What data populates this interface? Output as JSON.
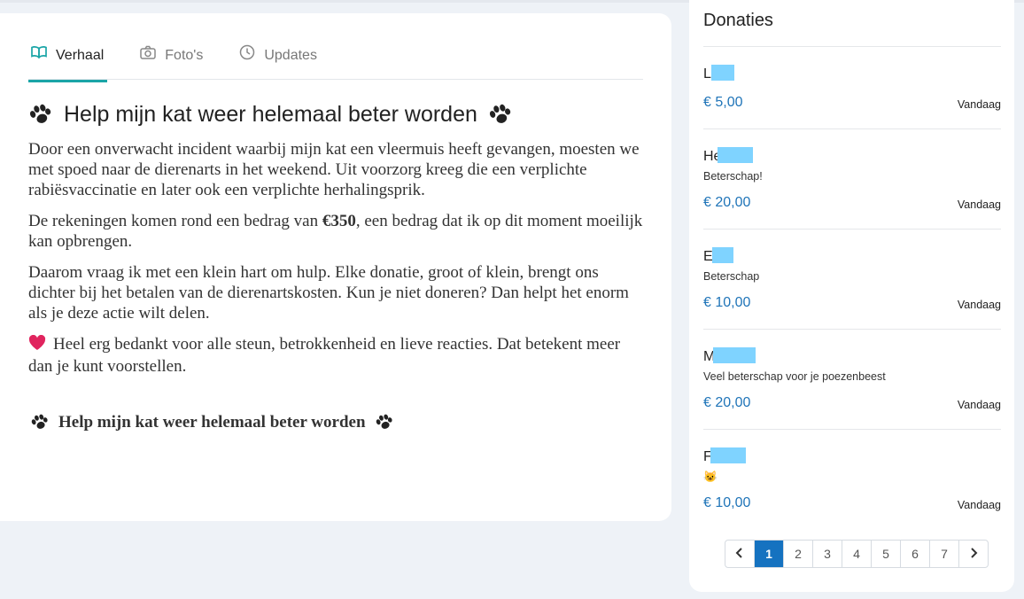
{
  "tabs": [
    {
      "label": "Verhaal",
      "icon": "book-icon",
      "active": true
    },
    {
      "label": "Foto's",
      "icon": "camera-icon",
      "active": false
    },
    {
      "label": "Updates",
      "icon": "clock-icon",
      "active": false
    }
  ],
  "story": {
    "title": "Help mijn kat weer helemaal beter worden",
    "p1": "Door een onverwacht incident waarbij mijn kat een vleermuis heeft gevangen, moesten we met spoed naar de dierenarts in het weekend. Uit voorzorg kreeg die een verplichte rabiësvaccinatie en later ook een verplichte herhalingsprik.",
    "p2_before": "De rekeningen komen rond een bedrag van ",
    "p2_bold": "€350",
    "p2_after": ", een bedrag dat ik op dit moment moeilijk kan opbrengen.",
    "p3": "Daarom vraag ik met een klein hart om hulp. Elke donatie, groot of klein, brengt ons dichter bij het betalen van de dierenartskosten. Kun je niet doneren? Dan helpt het enorm als je deze actie wilt delen.",
    "p4": "Heel erg bedankt voor alle steun, betrokkenheid en lieve reacties. Dat betekent meer dan je kunt voorstellen.",
    "subtitle": "Help mijn kat weer helemaal beter worden"
  },
  "donations": {
    "title": "Donaties",
    "items": [
      {
        "initial": "L",
        "message": "",
        "amount": "€ 5,00",
        "date": "Vandaag"
      },
      {
        "initial": "He",
        "message": "Beterschap!",
        "amount": "€ 20,00",
        "date": "Vandaag"
      },
      {
        "initial": "E",
        "message": "Beterschap",
        "amount": "€ 10,00",
        "date": "Vandaag"
      },
      {
        "initial": "M",
        "message": "Veel beterschap voor je poezenbeest",
        "amount": "€ 20,00",
        "date": "Vandaag"
      },
      {
        "initial": "F",
        "message": "😺",
        "amount": "€ 10,00",
        "date": "Vandaag"
      }
    ]
  },
  "pagination": {
    "prev": "‹",
    "next": "›",
    "pages": [
      "1",
      "2",
      "3",
      "4",
      "5",
      "6",
      "7"
    ],
    "current": "1"
  },
  "colors": {
    "accent": "#1aa5a7",
    "amount": "#1f74b8",
    "page_active": "#1572c0",
    "redaction": "#7fd3ff"
  }
}
